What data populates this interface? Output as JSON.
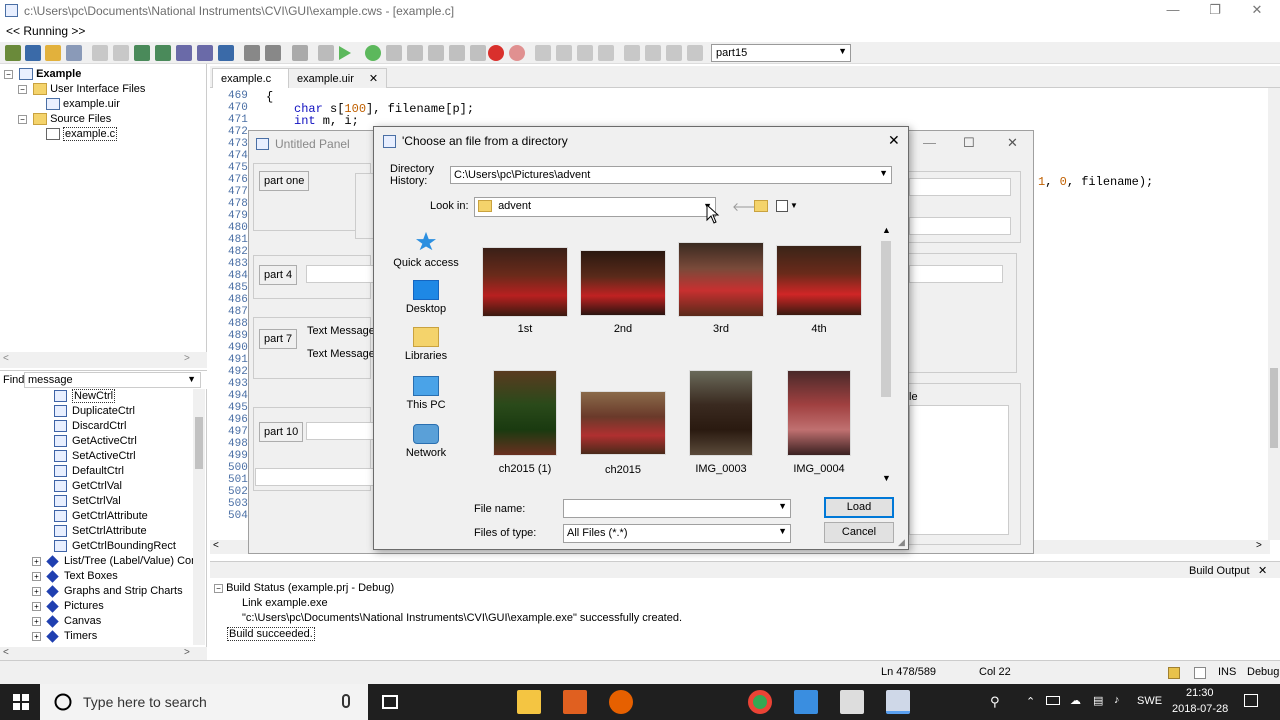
{
  "window": {
    "title": "c:\\Users\\pc\\Documents\\National Instruments\\CVI\\GUI\\example.cws - [example.c]",
    "minimize": "—",
    "restore": "❐",
    "close": "✕"
  },
  "menu": {
    "running": "<< Running >>"
  },
  "toolbar": {
    "panel_select": "part15"
  },
  "tree": {
    "root": "Example",
    "group1": "User Interface Files",
    "file1": "example.uir",
    "group2": "Source Files",
    "file2": "example.c"
  },
  "find": {
    "label": "Find",
    "value": "message"
  },
  "functions": [
    "NewCtrl",
    "DuplicateCtrl",
    "DiscardCtrl",
    "GetActiveCtrl",
    "SetActiveCtrl",
    "DefaultCtrl",
    "GetCtrlVal",
    "SetCtrlVal",
    "GetCtrlAttribute",
    "SetCtrlAttribute",
    "GetCtrlBoundingRect"
  ],
  "categories": [
    "List/Tree (Label/Value) Contr",
    "Text Boxes",
    "Graphs and Strip Charts",
    "Pictures",
    "Canvas",
    "Timers"
  ],
  "tabs": [
    "example.c",
    "example.uir"
  ],
  "code": {
    "line_numbers": [
      "469",
      "470",
      "471",
      "472",
      "473",
      "474",
      "475",
      "476",
      "477",
      "478",
      "479",
      "480",
      "481",
      "482",
      "483",
      "484",
      "485",
      "486",
      "487",
      "488",
      "489",
      "490",
      "491",
      "492",
      "493",
      "494",
      "495",
      "496",
      "497",
      "498",
      "499",
      "500",
      "501",
      "502",
      "503",
      "504"
    ],
    "line1": "{",
    "line2a": "char",
    "line2b": " s[",
    "line2c": "100",
    "line2d": "], filename[p];",
    "line3a": "int",
    "line3b": " m, i;",
    "tail_num1": "1",
    "tail_num2": "0",
    "tail_rest": ", filename);"
  },
  "untitled_panel": {
    "title": "Untitled Panel",
    "btn1": "part one",
    "btn2": "part 4",
    "btn3": "part 7",
    "btn4": "part 10",
    "msg1": "Text Message",
    "msg2": "Text Message",
    "tail_label": "le"
  },
  "dialog": {
    "title": "'Choose an file from a directory",
    "close": "✕",
    "dir_history_label": "Directory History:",
    "dir_history_value": "C:\\Users\\pc\\Pictures\\advent",
    "lookin_label": "Look in:",
    "lookin_value": "advent",
    "sidebar": [
      "Quick access",
      "Desktop",
      "Libraries",
      "This PC",
      "Network"
    ],
    "thumbs": [
      "1st",
      "2nd",
      "3rd",
      "4th",
      "ch2015 (1)",
      "ch2015",
      "IMG_0003",
      "IMG_0004"
    ],
    "filename_label": "File name:",
    "filename_value": "",
    "filetype_label": "Files of type:",
    "filetype_value": "All Files (*.*)",
    "load": "Load",
    "cancel": "Cancel"
  },
  "output": {
    "title": "Build Output",
    "close": "✕",
    "status": "Build Status (example.prj - Debug)",
    "link": "Link example.exe",
    "created": "\"c:\\Users\\pc\\Documents\\National Instruments\\CVI\\GUI\\example.exe\" successfully created.",
    "succeeded": "Build succeeded."
  },
  "statusbar": {
    "ln": "Ln 478/589",
    "col": "Col 22",
    "ins": "INS",
    "mode": "Debug"
  },
  "taskbar": {
    "search_placeholder": "Type here to search",
    "lang": "SWE",
    "time": "21:30",
    "date": "2018-07-28"
  }
}
